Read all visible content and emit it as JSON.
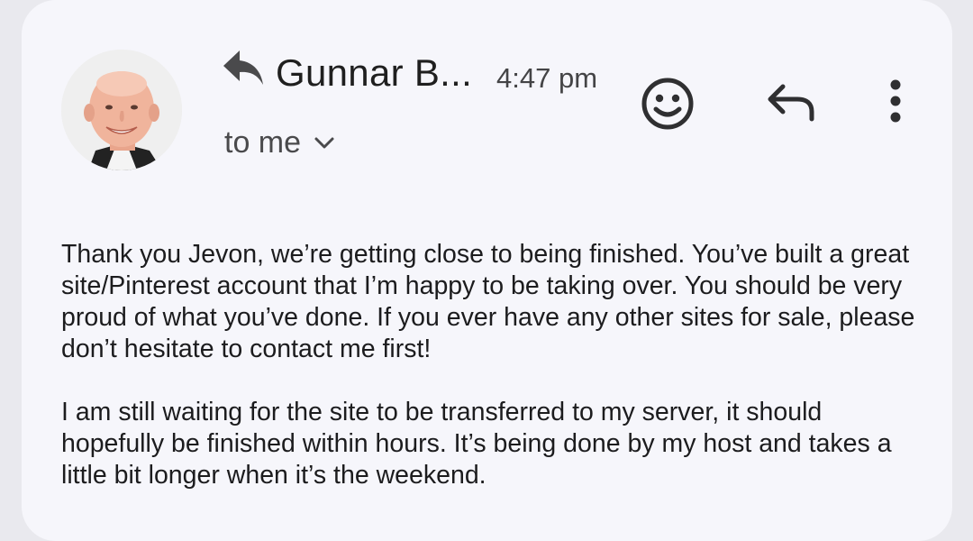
{
  "email": {
    "sender_name": "Gunnar B...",
    "time": "4:47 pm",
    "recipient_label": "to me",
    "body_paragraphs": [
      "Thank you Jevon, we’re getting close to being finished. You’ve built a great site/Pinterest account that I’m happy to be taking over. You should be very proud of what you’ve done. If you ever have any other sites for sale, please don’t hesitate to contact me first!",
      "I am still waiting for the site to be transferred to my server, it should hopefully be finished within hours. It’s being done by my host and takes a little bit longer when it’s the weekend."
    ]
  },
  "icons": {
    "replied_indicator": "reply-arrow-icon",
    "recipient_toggle": "chevron-down-icon",
    "emoji_reaction": "smiley-icon",
    "reply": "reply-icon",
    "more": "more-vert-icon"
  }
}
